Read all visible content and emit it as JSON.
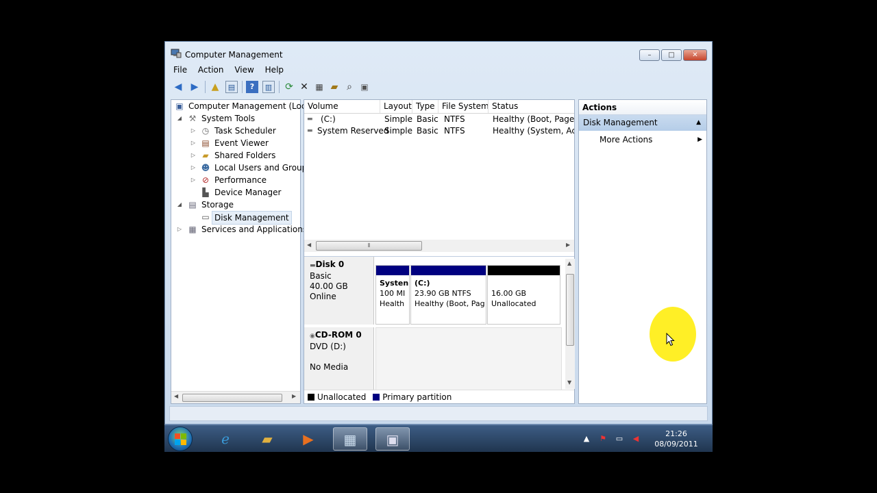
{
  "window": {
    "title": "Computer Management",
    "controls": {
      "minimize": "–",
      "maximize": "□",
      "close": "✕"
    }
  },
  "menu": [
    "File",
    "Action",
    "View",
    "Help"
  ],
  "toolbar": [
    "back-icon",
    "forward-icon",
    "up-folder-icon",
    "show-hide-tree-icon",
    "help-icon",
    "properties-pane-icon",
    "refresh-icon",
    "delete-icon",
    "properties-icon",
    "open-icon",
    "search-icon",
    "disk-icon"
  ],
  "tree": {
    "root": "Computer Management (Local",
    "system_tools": "System Tools",
    "task_scheduler": "Task Scheduler",
    "event_viewer": "Event Viewer",
    "shared_folders": "Shared Folders",
    "local_users": "Local Users and Groups",
    "performance": "Performance",
    "device_manager": "Device Manager",
    "storage": "Storage",
    "disk_management": "Disk Management",
    "services": "Services and Applications"
  },
  "volumes": {
    "headers": {
      "volume": "Volume",
      "layout": "Layout",
      "type": "Type",
      "fs": "File System",
      "status": "Status"
    },
    "rows": [
      {
        "volume": "(C:)",
        "layout": "Simple",
        "type": "Basic",
        "fs": "NTFS",
        "status": "Healthy (Boot, Page Fi"
      },
      {
        "volume": "System Reserved",
        "layout": "Simple",
        "type": "Basic",
        "fs": "NTFS",
        "status": "Healthy (System, Activ"
      }
    ]
  },
  "disks": {
    "disk0": {
      "name": "Disk 0",
      "type": "Basic",
      "size": "40.00 GB",
      "state": "Online"
    },
    "partitions": [
      {
        "name": "Systen",
        "size": "100 MI",
        "status": "Health"
      },
      {
        "name": "(C:)",
        "size": "23.90 GB NTFS",
        "status": "Healthy (Boot, Pag"
      },
      {
        "name": "",
        "size": "16.00 GB",
        "status": "Unallocated"
      }
    ],
    "cdrom": {
      "name": "CD-ROM 0",
      "drive": "DVD (D:)",
      "media": "No Media"
    }
  },
  "legend": {
    "unallocated": "Unallocated",
    "primary": "Primary partition"
  },
  "actions": {
    "header": "Actions",
    "section": "Disk Management",
    "more": "More Actions"
  },
  "taskbar": {
    "time": "21:26",
    "date": "08/09/2011"
  },
  "colors": {
    "primary_partition": "#000080",
    "unallocated": "#000000",
    "highlight": "#ffec00"
  }
}
